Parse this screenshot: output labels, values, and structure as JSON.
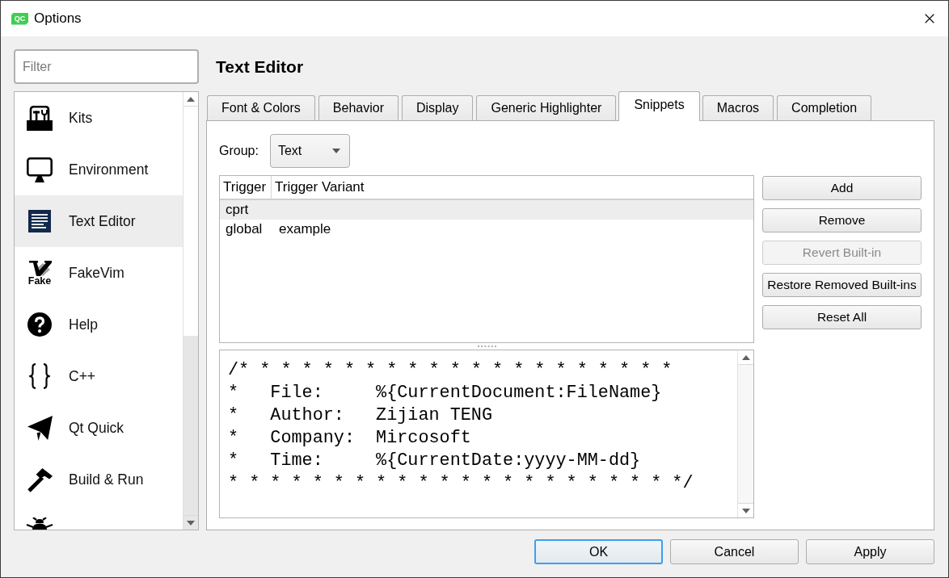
{
  "window": {
    "title": "Options",
    "logo_text": "QC"
  },
  "sidebar": {
    "filter": {
      "placeholder": "Filter"
    },
    "items": [
      {
        "label": "Kits",
        "selected": false
      },
      {
        "label": "Environment",
        "selected": false
      },
      {
        "label": "Text Editor",
        "selected": true
      },
      {
        "label": "FakeVim",
        "selected": false,
        "icon_text": "Fake"
      },
      {
        "label": "Help",
        "selected": false
      },
      {
        "label": "C++",
        "selected": false
      },
      {
        "label": "Qt Quick",
        "selected": false
      },
      {
        "label": "Build & Run",
        "selected": false
      }
    ]
  },
  "page": {
    "title": "Text Editor"
  },
  "tabs": [
    {
      "label": "Font & Colors",
      "selected": false
    },
    {
      "label": "Behavior",
      "selected": false
    },
    {
      "label": "Display",
      "selected": false
    },
    {
      "label": "Generic Highlighter",
      "selected": false
    },
    {
      "label": "Snippets",
      "selected": true
    },
    {
      "label": "Macros",
      "selected": false
    },
    {
      "label": "Completion",
      "selected": false
    }
  ],
  "snippets": {
    "group": {
      "label": "Group:",
      "value": "Text"
    },
    "table": {
      "columns": [
        "Trigger",
        "Trigger Variant"
      ],
      "rows": [
        {
          "trigger": "cprt",
          "selected": true
        },
        {
          "trigger": "global",
          "variant": "example",
          "selected": false
        }
      ]
    },
    "editor": {
      "lines": [
        "/* * * * * * * * * * * * * * * * * * * * *",
        "*   File:     %{CurrentDocument:FileName}",
        "*   Author:   Zijian TENG",
        "*   Company:  Mircosoft",
        "*   Time:     %{CurrentDate:yyyy-MM-dd}",
        "* * * * * * * * * * * * * * * * * * * * * */"
      ]
    },
    "buttons": [
      {
        "label": "Add",
        "disabled": false
      },
      {
        "label": "Remove",
        "disabled": false
      },
      {
        "label": "Revert Built-in",
        "disabled": true
      },
      {
        "label": "Restore Removed Built-ins",
        "disabled": false
      },
      {
        "label": "Reset All",
        "disabled": false
      }
    ]
  },
  "dialog_buttons": [
    {
      "label": "OK",
      "default": true
    },
    {
      "label": "Cancel",
      "default": false
    },
    {
      "label": "Apply",
      "default": false
    }
  ]
}
